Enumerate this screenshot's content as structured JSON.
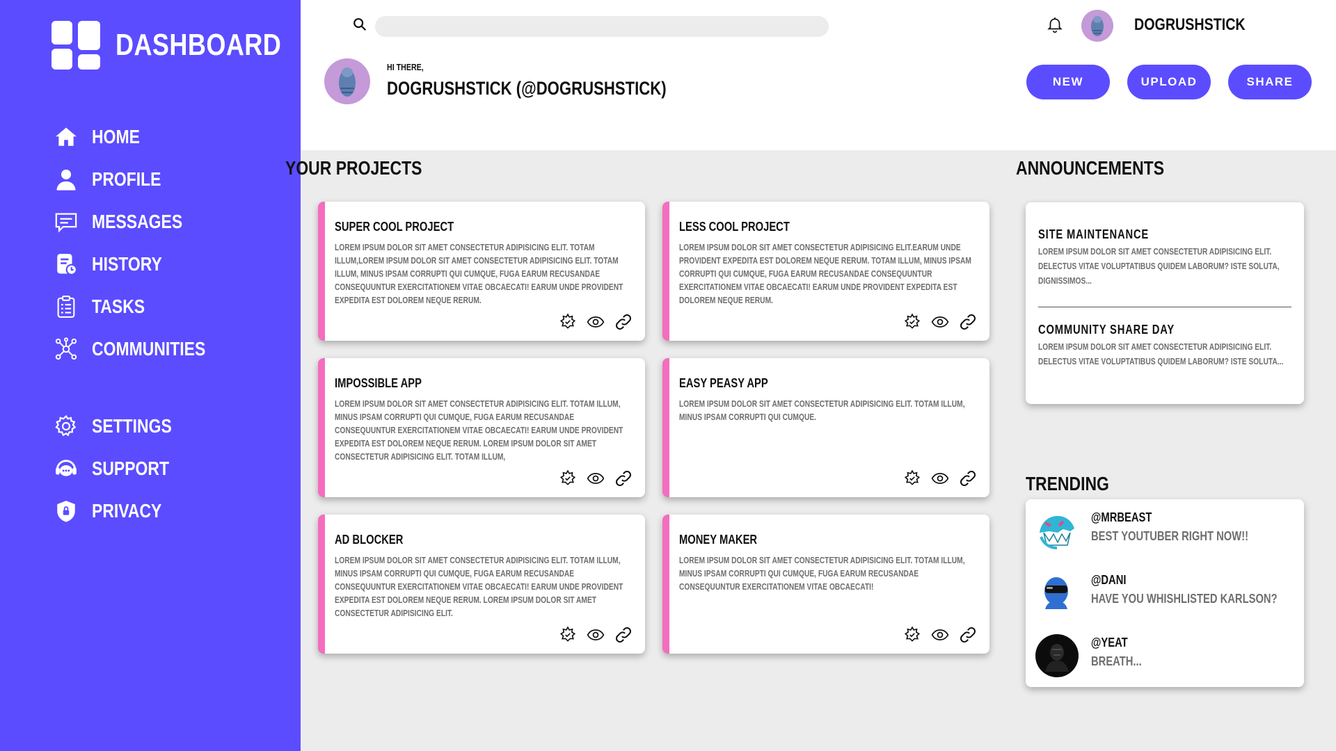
{
  "brand": {
    "title": "DASHBOARD",
    "logo_icon": "dashboard-grid-icon"
  },
  "colors": {
    "sidebar": "#5b4cff",
    "accent": "#5b4cff",
    "card_stripe": "#f46dbf",
    "background": "#ececec",
    "muted_text": "#6f6f6f"
  },
  "nav": {
    "main": [
      {
        "label": "Home",
        "icon": "home-icon"
      },
      {
        "label": "Profile",
        "icon": "user-icon"
      },
      {
        "label": "Messages",
        "icon": "message-icon"
      },
      {
        "label": "History",
        "icon": "history-icon"
      },
      {
        "label": "Tasks",
        "icon": "clipboard-icon"
      },
      {
        "label": "Communities",
        "icon": "network-icon"
      }
    ],
    "secondary": [
      {
        "label": "Settings",
        "icon": "gear-icon"
      },
      {
        "label": "Support",
        "icon": "support-icon"
      },
      {
        "label": "Privacy",
        "icon": "shield-icon"
      }
    ]
  },
  "header": {
    "search": {
      "value": "",
      "placeholder": ""
    },
    "username": "DOGRUSHSTICK",
    "greeting": "HI THERE,",
    "display_name": "DOGRUSHSTICK (@DOGRUSHSTICK)",
    "actions": [
      "New",
      "Upload",
      "Share"
    ]
  },
  "projects": {
    "title": "Your Projects",
    "items": [
      {
        "title": "Super Cool Project",
        "description": "Lorem ipsum dolor sit amet consectetur adipisicing elit. Totam illum,lorem ipsum dolor sit amet consectetur adipisicing elit. Totam illum, minus ipsam corrupti qui cumque, fuga earum recusandae consequuntur exercitationem vitae obcaecati! Earum unde provident expedita est dolorem neque rerum."
      },
      {
        "title": "Less Cool Project",
        "description": "Lorem ipsum dolor sit amet consectetur adipisicing elit.Earum unde provident expedita est dolorem neque rerum. Totam illum, minus ipsam corrupti qui cumque, fuga earum recusandae consequuntur exercitationem vitae obcaecati! Earum unde provident expedita est dolorem neque rerum."
      },
      {
        "title": "Impossible App",
        "description": "Lorem ipsum dolor sit amet consectetur adipisicing elit. Totam illum, minus ipsam corrupti qui cumque, fuga earum recusandae consequuntur exercitationem vitae obcaecati! Earum unde provident expedita est dolorem neque rerum. Lorem ipsum dolor sit amet consectetur adipisicing elit. Totam illum,"
      },
      {
        "title": "Easy Peasy App",
        "description": "Lorem ipsum dolor sit amet consectetur adipisicing elit. Totam illum, minus ipsam corrupti qui cumque."
      },
      {
        "title": "Ad Blocker",
        "description": "Lorem ipsum dolor sit amet consectetur adipisicing elit. Totam illum, minus ipsam corrupti qui cumque, fuga earum recusandae consequuntur exercitationem vitae obcaecati! Earum unde provident expedita est dolorem neque rerum. Lorem ipsum dolor sit amet consectetur adipisicing elit."
      },
      {
        "title": "Money Maker",
        "description": "Lorem ipsum dolor sit amet consectetur adipisicing elit. Totam illum, minus ipsam corrupti qui cumque, fuga earum recusandae consequuntur exercitationem vitae obcaecati!"
      }
    ],
    "card_action_icons": [
      "star-badge-icon",
      "eye-icon",
      "link-icon"
    ]
  },
  "announcements": {
    "title": "Announcements",
    "items": [
      {
        "title": "Site Maintenance",
        "description": "Lorem ipsum dolor sit amet consectetur adipisicing elit. Delectus vitae voluptatibus quidem laborum? Iste soluta, dignissimos..."
      },
      {
        "title": "Community Share Day",
        "description": "Lorem ipsum dolor sit amet consectetur adipisicing elit. Delectus vitae voluptatibus quidem laborum? Iste soluta..."
      }
    ]
  },
  "trending": {
    "title": "Trending",
    "items": [
      {
        "handle": "@mrbeast",
        "message": "Best youtuber right now!!"
      },
      {
        "handle": "@dani",
        "message": "Have you whishlisted Karlson?"
      },
      {
        "handle": "@yeat",
        "message": "Breath..."
      }
    ]
  }
}
